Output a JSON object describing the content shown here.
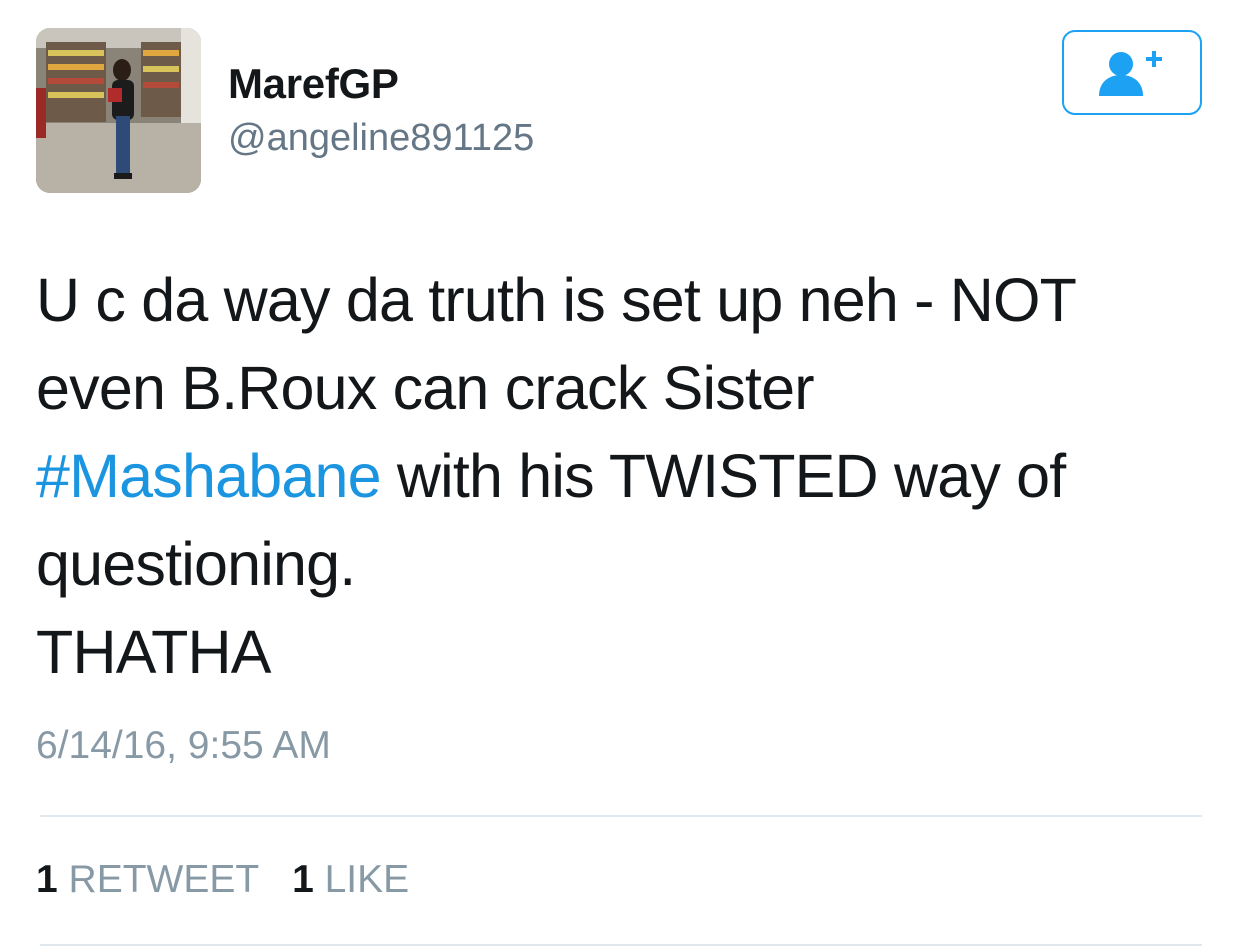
{
  "user": {
    "display_name": "MarefGP",
    "handle": "@angeline891125",
    "avatar_icon": "profile-photo"
  },
  "follow_button": {
    "icon": "add-user-icon",
    "color": "#1da1f2"
  },
  "tweet": {
    "lines": [
      "U c da way da truth is set up neh - NOT",
      "even B.Roux can crack Sister",
      "with his TWISTED way of",
      "questioning.",
      "THATHA"
    ],
    "hashtag": "#Mashabane",
    "hashtag_color": "#1b95e0"
  },
  "timestamp": "6/14/16, 9:55 AM",
  "stats": {
    "retweets_count": "1",
    "retweets_label": "RETWEET",
    "likes_count": "1",
    "likes_label": "LIKE"
  }
}
